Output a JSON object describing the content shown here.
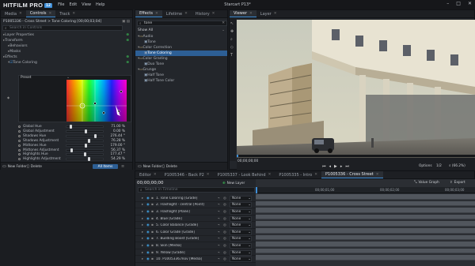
{
  "app": {
    "logo": "HITFILM PRO",
    "version": "12",
    "window_title": "Starcart P13*",
    "menu": [
      "File",
      "Edit",
      "View",
      "Help"
    ],
    "win_buttons": [
      "–",
      "□",
      "✕"
    ]
  },
  "left_panel": {
    "tabs": [
      "Media",
      "Controls",
      "Track"
    ],
    "clip_title": "P1005336 - Cross Street > Tone Coloring [00;00;03;04]",
    "search_placeholder": "Search in Controls",
    "rows": [
      {
        "label": "Layer Properties",
        "level": 0
      },
      {
        "label": "Transform",
        "level": 0
      },
      {
        "label": "Behaviors",
        "level": 1
      },
      {
        "label": "Masks",
        "level": 1
      },
      {
        "label": "Effects",
        "level": 0
      },
      {
        "label": "Tone Coloring",
        "level": 1,
        "checked": true
      }
    ],
    "curve_preset": "Preset",
    "params": [
      {
        "label": "Global Hue",
        "value": "71.00 %",
        "pos": 0.08
      },
      {
        "label": "Global Adjustment",
        "value": "0.00 %",
        "pos": 0.5
      },
      {
        "label": "Shadows Hue",
        "value": "276.44 °",
        "pos": 0.77
      },
      {
        "label": "Shadows Adjustment",
        "value": "76.28 %",
        "pos": 0.6
      },
      {
        "label": "Midtones Hue",
        "value": "179.00 °",
        "pos": 0.5
      },
      {
        "label": "Midtones Adjustment",
        "value": "56.37 %",
        "pos": 0.1
      },
      {
        "label": "Highlights Hue",
        "value": "177.47 °",
        "pos": 0.49
      },
      {
        "label": "Highlights Adjustment",
        "value": "54.29 %",
        "pos": 0.6
      }
    ],
    "footer": {
      "new_folder": "New Folder",
      "delete": "Delete",
      "all_items": "All Items"
    }
  },
  "effects_panel": {
    "tabs": [
      "Effects",
      "Lifetime",
      "History"
    ],
    "search_value": "tone",
    "show_all": "Show All",
    "tree": [
      {
        "label": "Audio",
        "level": 0,
        "expanded": true
      },
      {
        "label": "Tone",
        "level": 1
      },
      {
        "label": "Color Correction",
        "level": 0,
        "expanded": true
      },
      {
        "label": "Tone Coloring",
        "level": 1,
        "selected": true
      },
      {
        "label": "Color Grading",
        "level": 0,
        "expanded": true
      },
      {
        "label": "Duo Tone",
        "level": 1
      },
      {
        "label": "Grunge",
        "level": 0,
        "expanded": true
      },
      {
        "label": "Half Tone",
        "level": 1
      },
      {
        "label": "Half Tone Color",
        "level": 1
      }
    ]
  },
  "viewer": {
    "tabs": [
      "Viewer",
      "Layer"
    ],
    "timecode": "00;00;00;00",
    "options": "Options",
    "zoom": "(66.2%)",
    "page": "1/2"
  },
  "timeline": {
    "tabs": [
      "Editor",
      "P1005346 - Back P2",
      "P1005337 - Look Behind",
      "P1005335 - Intro",
      "P1005336 - Cross Street"
    ],
    "timecode": "00;00;00;00",
    "new_layer": "New Layer",
    "value_graph": "Value Graph",
    "export": "Export",
    "search_placeholder": "Search in Timeline",
    "ruler": [
      "00;00;01;00",
      "00;00;02;00",
      "00;00;03;00"
    ],
    "layers": [
      {
        "name": "1. Tone Coloring [Grade]",
        "blend": "None"
      },
      {
        "name": "2. Flashlight - central [Point]",
        "blend": "None"
      },
      {
        "name": "3. Flashlight [Plane]",
        "blend": "None"
      },
      {
        "name": "4. Blue [Grade]",
        "blend": "None"
      },
      {
        "name": "5. Color Balance [Grade]",
        "blend": "None"
      },
      {
        "name": "6. Color Grade [Grade]",
        "blend": "None"
      },
      {
        "name": "7. Building Boost [Grade]",
        "blend": "None"
      },
      {
        "name": "8. Skin [Media]",
        "blend": "None"
      },
      {
        "name": "9. Yellow [Grade]",
        "blend": "None"
      },
      {
        "name": "10. P1005336.mov [Media]",
        "blend": "None"
      }
    ]
  },
  "colors": {
    "accent": "#3f8fd8",
    "green": "#3fd15a",
    "panel": "#23262b"
  }
}
